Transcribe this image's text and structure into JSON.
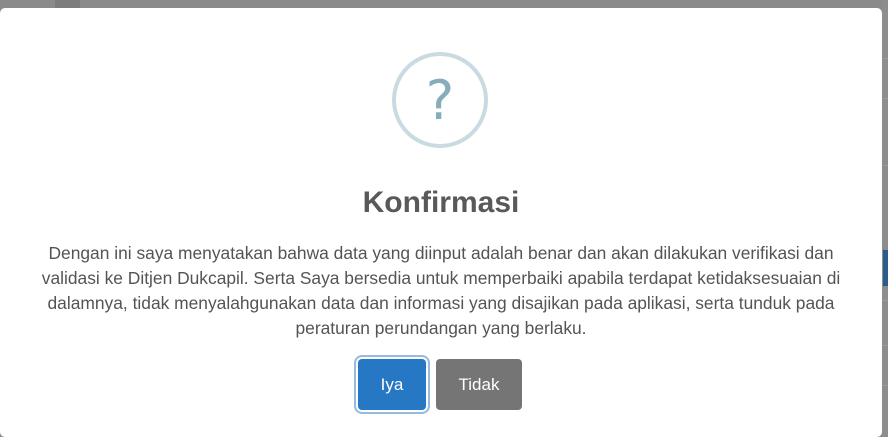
{
  "dialog": {
    "icon": "question-mark-icon",
    "icon_glyph": "?",
    "title": "Konfirmasi",
    "message": "Dengan ini saya menyatakan bahwa data yang diinput adalah benar dan akan dilakukan verifikasi dan validasi ke Ditjen Dukcapil. Serta Saya bersedia untuk memperbaiki apabila terdapat ketidaksesuaian di dalamnya, tidak menyalahgunakan data dan informasi yang disajikan pada aplikasi, serta tunduk pada peraturan perundangan yang berlaku.",
    "confirm_label": "Iya",
    "cancel_label": "Tidak"
  },
  "colors": {
    "confirm_button": "#2778c4",
    "cancel_button": "#757575",
    "icon_ring": "#c9dae1",
    "icon_glyph": "#87adbd",
    "title_text": "#595959",
    "overlay": "#8a8a8a"
  }
}
